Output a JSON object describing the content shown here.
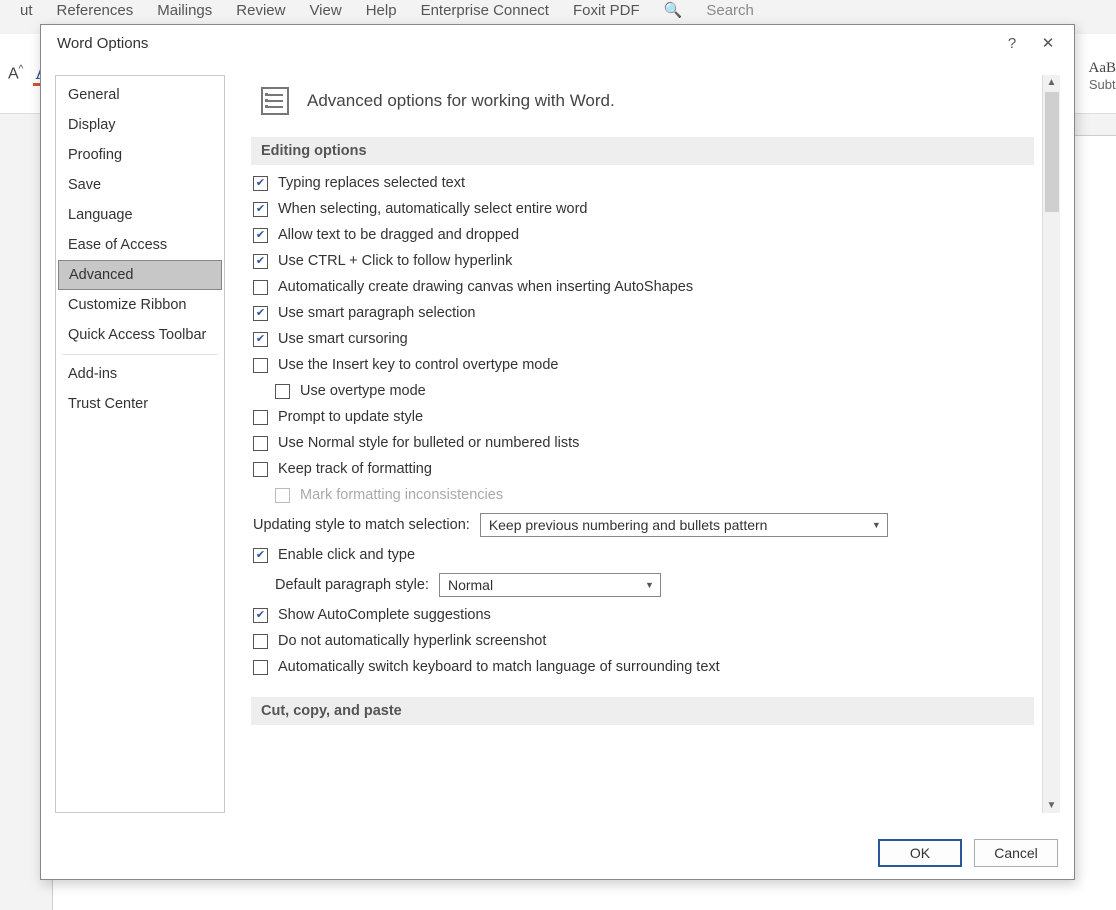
{
  "ribbon": {
    "tabs": [
      "ut",
      "References",
      "Mailings",
      "Review",
      "View",
      "Help",
      "Enterprise Connect",
      "Foxit PDF"
    ],
    "search": "Search",
    "style_sample": "AaB",
    "style_name": "Subt"
  },
  "dialog": {
    "title": "Word Options",
    "help": "?",
    "close": "✕",
    "nav": {
      "items_top": [
        "General",
        "Display",
        "Proofing",
        "Save",
        "Language",
        "Ease of Access",
        "Advanced",
        "Customize Ribbon",
        "Quick Access Toolbar"
      ],
      "items_bottom": [
        "Add-ins",
        "Trust Center"
      ],
      "selected": "Advanced"
    },
    "head": "Advanced options for working with Word.",
    "sections": {
      "editing": {
        "header": "Editing options",
        "typing_replaces": "Typing replaces selected text",
        "select_word": "When selecting, automatically select entire word",
        "drag_drop": "Allow text to be dragged and dropped",
        "ctrl_click": "Use CTRL + Click to follow hyperlink",
        "auto_canvas": "Automatically create drawing canvas when inserting AutoShapes",
        "smart_para": "Use smart paragraph selection",
        "smart_cursor": "Use smart cursoring",
        "insert_key": "Use the Insert key to control overtype mode",
        "overtype": "Use overtype mode",
        "prompt_style": "Prompt to update style",
        "normal_lists": "Use Normal style for bulleted or numbered lists",
        "keep_format": "Keep track of formatting",
        "mark_format": "Mark formatting inconsistencies",
        "updating_style_label": "Updating style to match selection:",
        "updating_style_value": "Keep previous numbering and bullets pattern",
        "click_type": "Enable click and type",
        "default_para_label": "Default paragraph style:",
        "default_para_value": "Normal",
        "autocomplete": "Show AutoComplete suggestions",
        "no_hyperlink_ss": "Do not automatically hyperlink screenshot",
        "auto_kbd": "Automatically switch keyboard to match language of surrounding text"
      },
      "ccp": {
        "header": "Cut, copy, and paste"
      }
    },
    "buttons": {
      "ok": "OK",
      "cancel": "Cancel"
    }
  }
}
